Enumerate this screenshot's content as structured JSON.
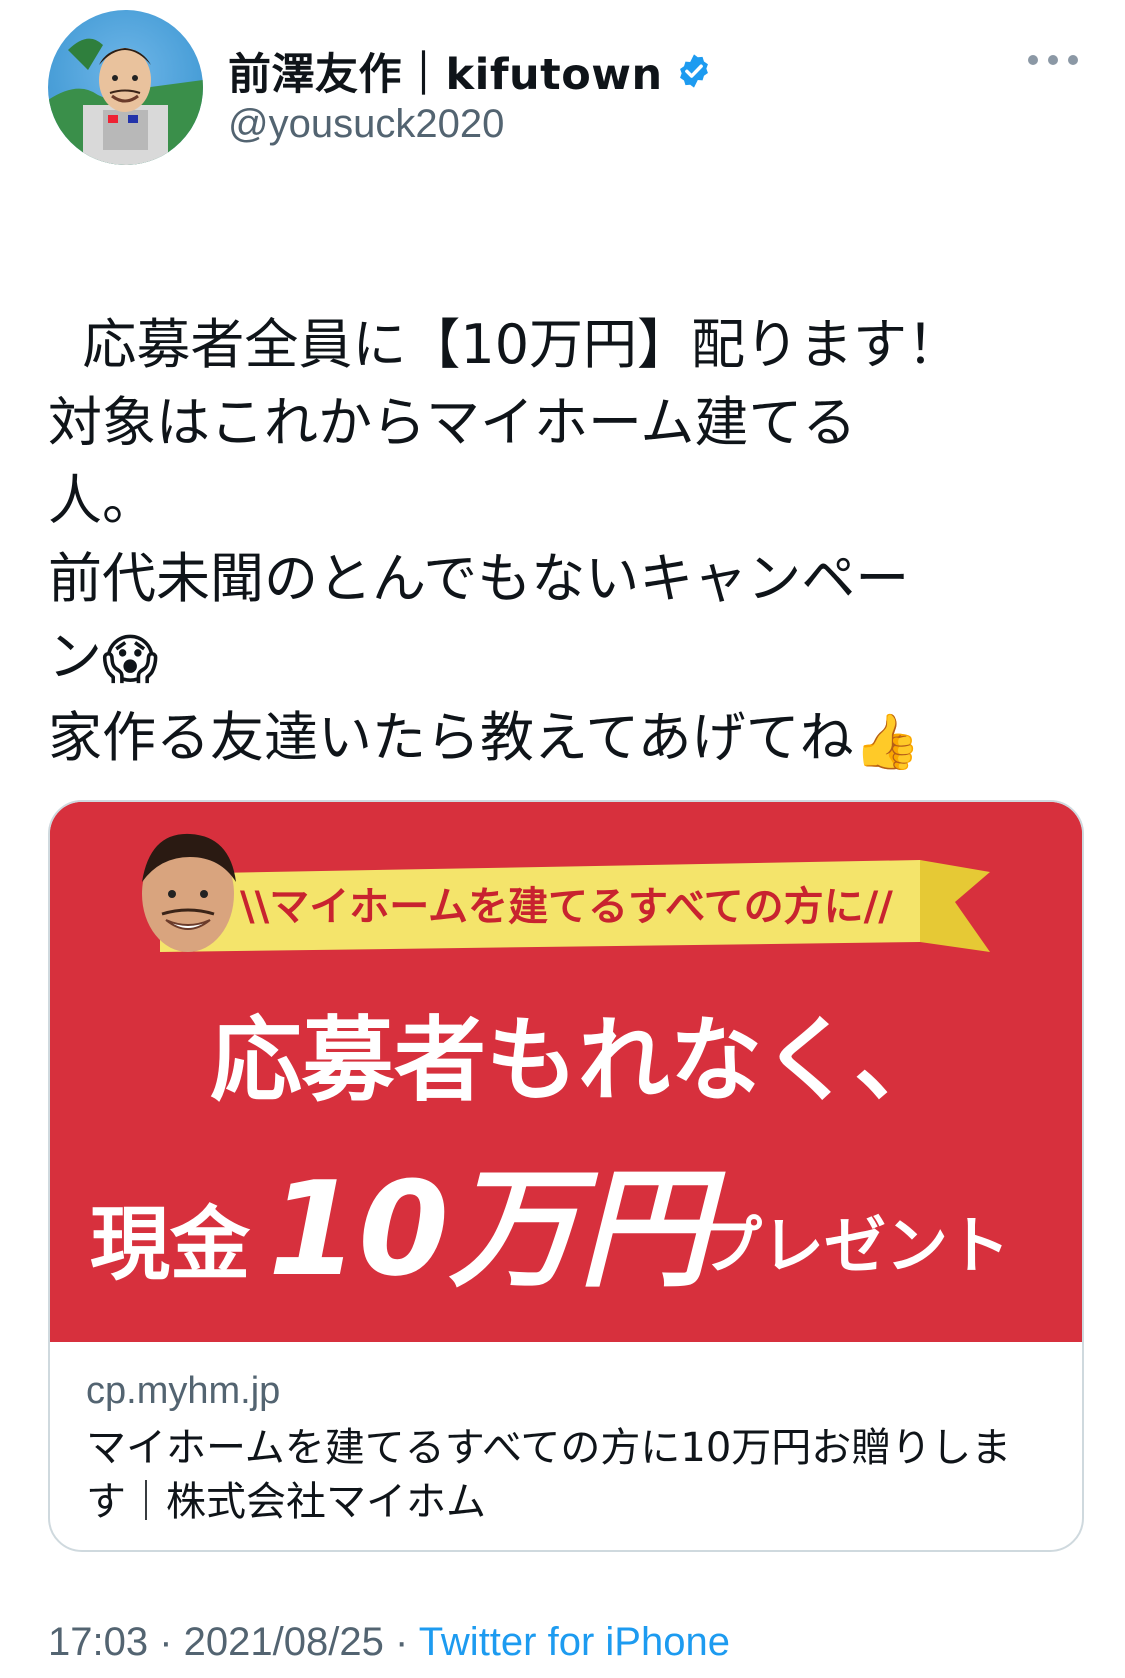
{
  "user": {
    "display_name": "前澤友作｜kifutown",
    "handle": "@yousuck2020",
    "verified": true
  },
  "tweet": {
    "text": "応募者全員に【10万円】配ります！\n対象はこれからマイホーム建てる\n人。\n前代未聞のとんでもないキャンペー\nン😱\n家作る友達いたら教えてあげてね👍",
    "emojis": [
      "face-screaming-in-fear-icon",
      "thumbs-up-icon"
    ]
  },
  "card": {
    "image": {
      "banner": "\\\\マイホームを建てるすべての方に//",
      "headline_line1": "応募者もれなく、",
      "headline_line2_prefix": "現金",
      "headline_line2_amount": "10万円",
      "headline_line2_suffix": "プレゼント",
      "background_color": "#d7303d",
      "banner_color": "#f4e46b"
    },
    "domain": "cp.myhm.jp",
    "title": "マイホームを建てるすべての方に10万円お贈りします｜株式会社マイホム"
  },
  "meta": {
    "time": "17:03",
    "separator": " · ",
    "date": "2021/08/25",
    "source": "Twitter for iPhone"
  },
  "colors": {
    "accent": "#1d9bf0",
    "secondary_text": "#536471",
    "border": "#cfd9de"
  }
}
